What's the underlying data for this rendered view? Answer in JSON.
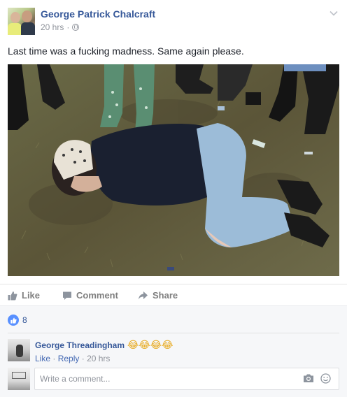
{
  "post": {
    "author": "George Patrick Chalcraft",
    "time": "20 hrs",
    "separator": "·",
    "privacy_icon": "globe-icon",
    "text": "Last time was a fucking madness. Same again please."
  },
  "actions": {
    "like_label": "Like",
    "comment_label": "Comment",
    "share_label": "Share"
  },
  "reactions": {
    "like_count": "8"
  },
  "comment": {
    "author": "George Threadingham",
    "text": "😂😂😂😂",
    "like_label": "Like",
    "reply_label": "Reply",
    "time": "20 hrs",
    "separator": "·"
  },
  "composer": {
    "placeholder": "Write a comment..."
  },
  "colors": {
    "link_blue": "#365899",
    "like_badge": "#5890ff",
    "muted": "#90949c"
  }
}
